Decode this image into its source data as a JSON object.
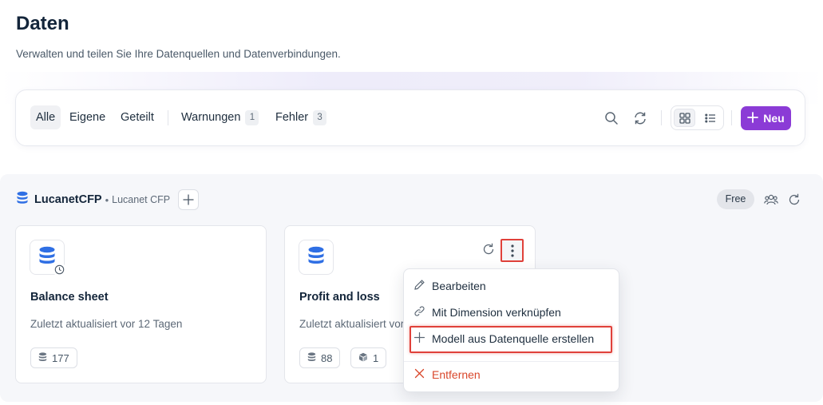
{
  "header": {
    "title": "Daten",
    "subtitle": "Verwalten und teilen Sie Ihre Datenquellen und Datenverbindungen."
  },
  "toolbar": {
    "filters": {
      "all": "Alle",
      "own": "Eigene",
      "shared": "Geteilt",
      "warnings": "Warnungen",
      "warnings_count": "1",
      "errors": "Fehler",
      "errors_count": "3"
    },
    "new_label": "Neu",
    "icons": [
      "search-icon",
      "refresh-icon",
      "grid-view-icon",
      "list-view-icon",
      "plus-icon"
    ]
  },
  "section": {
    "name": "LucanetCFP",
    "subname": "Lucanet CFP",
    "plan_badge": "Free",
    "icons": [
      "database-icon",
      "plus-icon",
      "users-icon",
      "refresh-icon"
    ]
  },
  "cards": [
    {
      "title": "Balance sheet",
      "meta": "Zuletzt aktualisiert vor 12 Tagen",
      "chips": [
        {
          "icon": "database-icon",
          "value": "177"
        }
      ]
    },
    {
      "title": "Profit and loss",
      "meta": "Zuletzt aktualisiert vor 12 Tagen",
      "chips": [
        {
          "icon": "database-icon",
          "value": "88"
        },
        {
          "icon": "cube-icon",
          "value": "1"
        }
      ]
    }
  ],
  "context_menu": {
    "items": [
      {
        "label": "Bearbeiten",
        "icon": "pencil-icon"
      },
      {
        "label": "Mit Dimension verknüpfen",
        "icon": "link-icon"
      },
      {
        "label": "Modell aus Datenquelle erstellen",
        "icon": "plus-icon"
      },
      {
        "label": "Entfernen",
        "icon": "close-icon"
      }
    ]
  },
  "colors": {
    "accent": "#8b3bd6",
    "primary_icon": "#2f6fe4",
    "danger": "#d9472b",
    "highlight": "#e0413a"
  }
}
